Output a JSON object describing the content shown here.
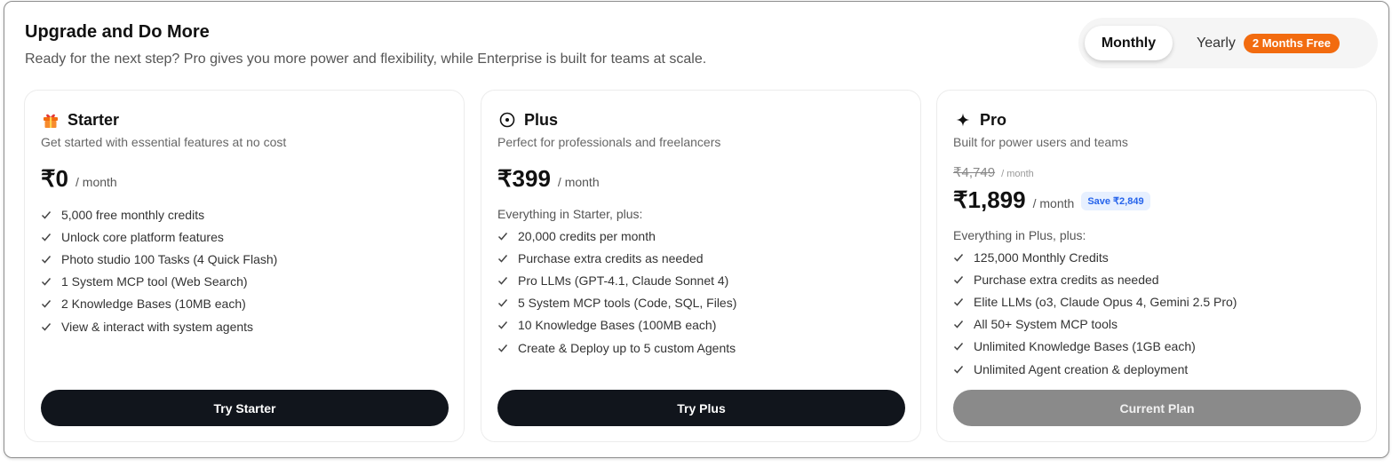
{
  "header": {
    "title": "Upgrade and Do More",
    "subtitle": "Ready for the next step? Pro gives you more power and flexibility, while Enterprise is built for teams at scale."
  },
  "billing_toggle": {
    "monthly_label": "Monthly",
    "yearly_label": "Yearly",
    "yearly_badge": "2 Months Free",
    "selected": "Monthly"
  },
  "plans": [
    {
      "name": "Starter",
      "icon": "gift-icon",
      "description": "Get started with essential features at no cost",
      "price": "₹0",
      "per": "/ month",
      "features": [
        "5,000 free monthly credits",
        "Unlock core platform features",
        "Photo studio 100 Tasks (4 Quick Flash)",
        "1 System MCP tool (Web Search)",
        "2 Knowledge Bases (10MB each)",
        "View & interact with system agents"
      ],
      "cta": "Try Starter"
    },
    {
      "name": "Plus",
      "icon": "circle-dot-icon",
      "description": "Perfect for professionals and freelancers",
      "price": "₹399",
      "per": "/ month",
      "intro": "Everything in Starter, plus:",
      "features": [
        "20,000 credits per month",
        "Purchase extra credits as needed",
        "Pro LLMs (GPT-4.1, Claude Sonnet 4)",
        "5 System MCP tools (Code, SQL, Files)",
        "10 Knowledge Bases (100MB each)",
        "Create & Deploy up to 5 custom Agents"
      ],
      "cta": "Try Plus"
    },
    {
      "name": "Pro",
      "icon": "sparkle-icon",
      "description": "Built for power users and teams",
      "old_price": "₹4,749",
      "old_per": "/ month",
      "price": "₹1,899",
      "per": "/ month",
      "save_badge": "Save ₹2,849",
      "intro": "Everything in Plus, plus:",
      "features": [
        "125,000 Monthly Credits",
        "Purchase extra credits as needed",
        "Elite LLMs (o3, Claude Opus 4, Gemini 2.5 Pro)",
        "All 50+ System MCP tools",
        "Unlimited Knowledge Bases (1GB each)",
        "Unlimited Agent creation & deployment"
      ],
      "cta": "Current Plan"
    }
  ],
  "colors": {
    "accent_orange": "#f26b0f",
    "button_dark": "#11151c",
    "button_disabled": "#8a8a8a",
    "save_badge_bg": "#e7f0ff",
    "save_badge_text": "#2563eb"
  }
}
